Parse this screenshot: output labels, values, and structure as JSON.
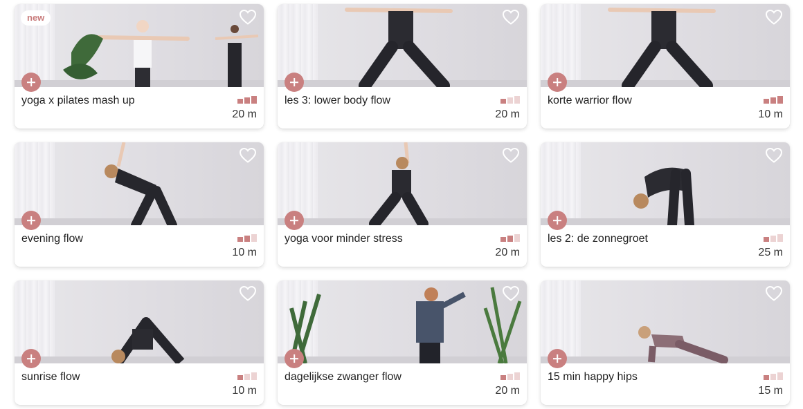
{
  "colors": {
    "accent": "#c98080",
    "level_off": "#ecd3d3",
    "badge_text": "#c97c7c",
    "title": "#222222"
  },
  "cards": [
    {
      "title": "yoga x pilates mash up",
      "duration": "20 m",
      "badge": "new",
      "level": 3,
      "favorite_icon": "heart-outline-icon",
      "add_icon": "plus-icon"
    },
    {
      "title": "les 3: lower body flow",
      "duration": "20 m",
      "badge": "",
      "level": 1,
      "favorite_icon": "heart-outline-icon",
      "add_icon": "plus-icon"
    },
    {
      "title": "korte warrior flow",
      "duration": "10 m",
      "badge": "",
      "level": 3,
      "favorite_icon": "heart-outline-icon",
      "add_icon": "plus-icon"
    },
    {
      "title": "evening flow",
      "duration": "10 m",
      "badge": "",
      "level": 2,
      "favorite_icon": "heart-outline-icon",
      "add_icon": "plus-icon"
    },
    {
      "title": "yoga voor minder stress",
      "duration": "20 m",
      "badge": "",
      "level": 2,
      "favorite_icon": "heart-outline-icon",
      "add_icon": "plus-icon"
    },
    {
      "title": "les 2: de zonnegroet",
      "duration": "25 m",
      "badge": "",
      "level": 1,
      "favorite_icon": "heart-outline-icon",
      "add_icon": "plus-icon"
    },
    {
      "title": "sunrise flow",
      "duration": "10 m",
      "badge": "",
      "level": 1,
      "favorite_icon": "heart-outline-icon",
      "add_icon": "plus-icon"
    },
    {
      "title": "dagelijkse zwanger flow",
      "duration": "20 m",
      "badge": "",
      "level": 1,
      "favorite_icon": "heart-outline-icon",
      "add_icon": "plus-icon"
    },
    {
      "title": "15 min happy hips",
      "duration": "15 m",
      "badge": "",
      "level": 1,
      "favorite_icon": "heart-outline-icon",
      "add_icon": "plus-icon"
    }
  ]
}
